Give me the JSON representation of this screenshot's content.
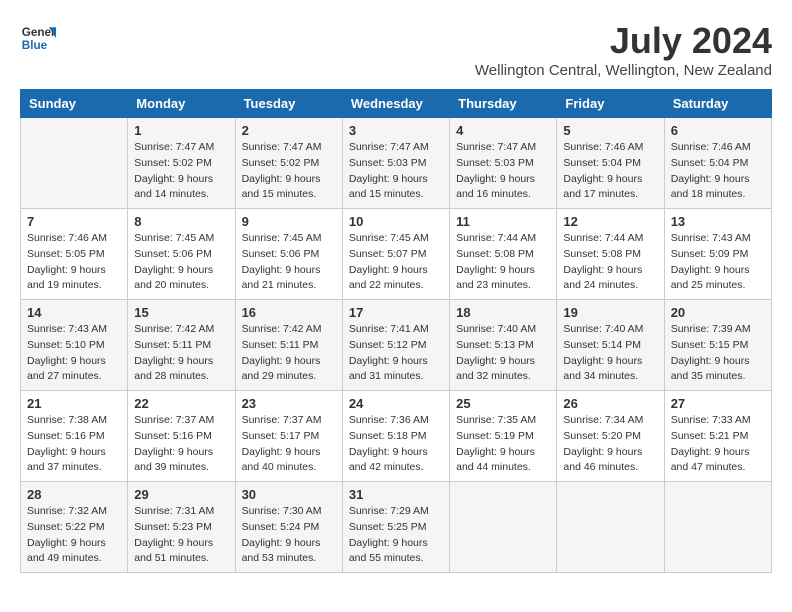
{
  "logo": {
    "line1": "General",
    "line2": "Blue"
  },
  "title": "July 2024",
  "location": "Wellington Central, Wellington, New Zealand",
  "days_header": [
    "Sunday",
    "Monday",
    "Tuesday",
    "Wednesday",
    "Thursday",
    "Friday",
    "Saturday"
  ],
  "weeks": [
    [
      {
        "day": "",
        "info": ""
      },
      {
        "day": "1",
        "info": "Sunrise: 7:47 AM\nSunset: 5:02 PM\nDaylight: 9 hours\nand 14 minutes."
      },
      {
        "day": "2",
        "info": "Sunrise: 7:47 AM\nSunset: 5:02 PM\nDaylight: 9 hours\nand 15 minutes."
      },
      {
        "day": "3",
        "info": "Sunrise: 7:47 AM\nSunset: 5:03 PM\nDaylight: 9 hours\nand 15 minutes."
      },
      {
        "day": "4",
        "info": "Sunrise: 7:47 AM\nSunset: 5:03 PM\nDaylight: 9 hours\nand 16 minutes."
      },
      {
        "day": "5",
        "info": "Sunrise: 7:46 AM\nSunset: 5:04 PM\nDaylight: 9 hours\nand 17 minutes."
      },
      {
        "day": "6",
        "info": "Sunrise: 7:46 AM\nSunset: 5:04 PM\nDaylight: 9 hours\nand 18 minutes."
      }
    ],
    [
      {
        "day": "7",
        "info": "Sunrise: 7:46 AM\nSunset: 5:05 PM\nDaylight: 9 hours\nand 19 minutes."
      },
      {
        "day": "8",
        "info": "Sunrise: 7:45 AM\nSunset: 5:06 PM\nDaylight: 9 hours\nand 20 minutes."
      },
      {
        "day": "9",
        "info": "Sunrise: 7:45 AM\nSunset: 5:06 PM\nDaylight: 9 hours\nand 21 minutes."
      },
      {
        "day": "10",
        "info": "Sunrise: 7:45 AM\nSunset: 5:07 PM\nDaylight: 9 hours\nand 22 minutes."
      },
      {
        "day": "11",
        "info": "Sunrise: 7:44 AM\nSunset: 5:08 PM\nDaylight: 9 hours\nand 23 minutes."
      },
      {
        "day": "12",
        "info": "Sunrise: 7:44 AM\nSunset: 5:08 PM\nDaylight: 9 hours\nand 24 minutes."
      },
      {
        "day": "13",
        "info": "Sunrise: 7:43 AM\nSunset: 5:09 PM\nDaylight: 9 hours\nand 25 minutes."
      }
    ],
    [
      {
        "day": "14",
        "info": "Sunrise: 7:43 AM\nSunset: 5:10 PM\nDaylight: 9 hours\nand 27 minutes."
      },
      {
        "day": "15",
        "info": "Sunrise: 7:42 AM\nSunset: 5:11 PM\nDaylight: 9 hours\nand 28 minutes."
      },
      {
        "day": "16",
        "info": "Sunrise: 7:42 AM\nSunset: 5:11 PM\nDaylight: 9 hours\nand 29 minutes."
      },
      {
        "day": "17",
        "info": "Sunrise: 7:41 AM\nSunset: 5:12 PM\nDaylight: 9 hours\nand 31 minutes."
      },
      {
        "day": "18",
        "info": "Sunrise: 7:40 AM\nSunset: 5:13 PM\nDaylight: 9 hours\nand 32 minutes."
      },
      {
        "day": "19",
        "info": "Sunrise: 7:40 AM\nSunset: 5:14 PM\nDaylight: 9 hours\nand 34 minutes."
      },
      {
        "day": "20",
        "info": "Sunrise: 7:39 AM\nSunset: 5:15 PM\nDaylight: 9 hours\nand 35 minutes."
      }
    ],
    [
      {
        "day": "21",
        "info": "Sunrise: 7:38 AM\nSunset: 5:16 PM\nDaylight: 9 hours\nand 37 minutes."
      },
      {
        "day": "22",
        "info": "Sunrise: 7:37 AM\nSunset: 5:16 PM\nDaylight: 9 hours\nand 39 minutes."
      },
      {
        "day": "23",
        "info": "Sunrise: 7:37 AM\nSunset: 5:17 PM\nDaylight: 9 hours\nand 40 minutes."
      },
      {
        "day": "24",
        "info": "Sunrise: 7:36 AM\nSunset: 5:18 PM\nDaylight: 9 hours\nand 42 minutes."
      },
      {
        "day": "25",
        "info": "Sunrise: 7:35 AM\nSunset: 5:19 PM\nDaylight: 9 hours\nand 44 minutes."
      },
      {
        "day": "26",
        "info": "Sunrise: 7:34 AM\nSunset: 5:20 PM\nDaylight: 9 hours\nand 46 minutes."
      },
      {
        "day": "27",
        "info": "Sunrise: 7:33 AM\nSunset: 5:21 PM\nDaylight: 9 hours\nand 47 minutes."
      }
    ],
    [
      {
        "day": "28",
        "info": "Sunrise: 7:32 AM\nSunset: 5:22 PM\nDaylight: 9 hours\nand 49 minutes."
      },
      {
        "day": "29",
        "info": "Sunrise: 7:31 AM\nSunset: 5:23 PM\nDaylight: 9 hours\nand 51 minutes."
      },
      {
        "day": "30",
        "info": "Sunrise: 7:30 AM\nSunset: 5:24 PM\nDaylight: 9 hours\nand 53 minutes."
      },
      {
        "day": "31",
        "info": "Sunrise: 7:29 AM\nSunset: 5:25 PM\nDaylight: 9 hours\nand 55 minutes."
      },
      {
        "day": "",
        "info": ""
      },
      {
        "day": "",
        "info": ""
      },
      {
        "day": "",
        "info": ""
      }
    ]
  ]
}
